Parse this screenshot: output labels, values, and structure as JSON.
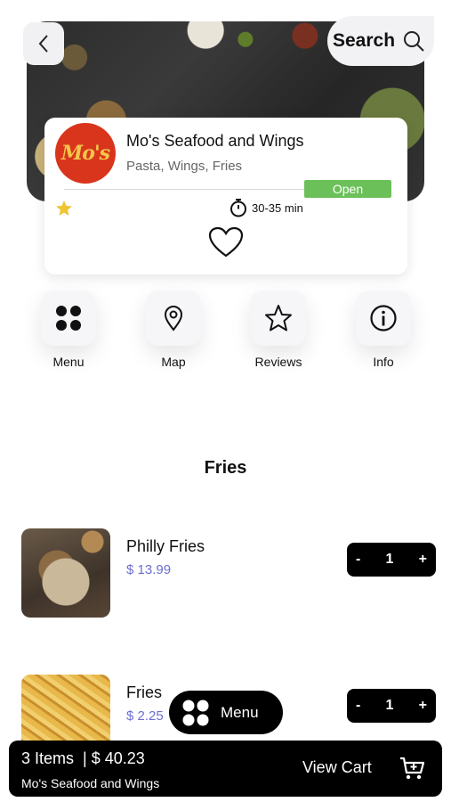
{
  "header": {
    "back_icon": "chevron-left-icon",
    "search_label": "Search",
    "search_icon": "magnifier-icon"
  },
  "restaurant": {
    "logo_text": "Mo's",
    "name": "Mo's Seafood and Wings",
    "cuisine": "Pasta, Wings, Fries",
    "status": "Open",
    "status_color": "#6cc05a",
    "rating_icon": "star-icon",
    "rating_color": "#f0c432",
    "delivery_time": "30-35 min"
  },
  "actions": [
    {
      "label": "Menu",
      "icon": "grid-dots-icon"
    },
    {
      "label": "Map",
      "icon": "map-pin-icon"
    },
    {
      "label": "Reviews",
      "icon": "star-outline-icon"
    },
    {
      "label": "Info",
      "icon": "info-icon"
    }
  ],
  "section": {
    "title": "Fries"
  },
  "items": [
    {
      "name": "Philly Fries",
      "price": "$ 13.99",
      "quantity": "1",
      "minus": "-",
      "plus": "+"
    },
    {
      "name": "Fries",
      "price": "$ 2.25",
      "quantity": "1",
      "minus": "-",
      "plus": "+"
    }
  ],
  "floating_menu": {
    "label": "Menu"
  },
  "cart": {
    "summary": "3 Items  | $ 40.23",
    "restaurant": "Mo's Seafood and Wings",
    "view_label": "View Cart"
  },
  "colors": {
    "accent": "#000000",
    "price": "#6b6fd0"
  }
}
